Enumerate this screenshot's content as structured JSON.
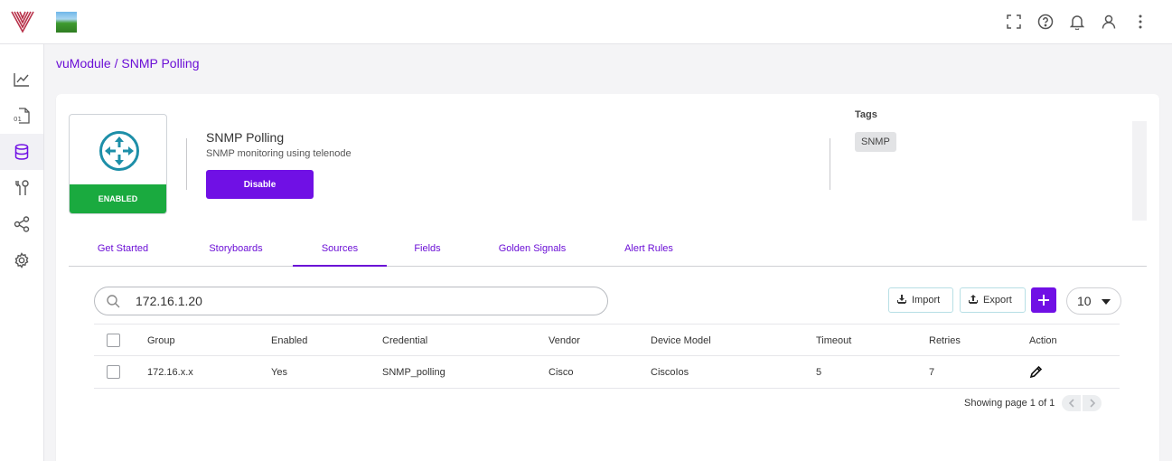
{
  "colors": {
    "brand": "#7010e5",
    "link": "#6b0fd6",
    "enabled": "#1aaa3f",
    "logo": "#b8324a"
  },
  "topbar": {
    "icons": [
      "fullscreen-icon",
      "help-icon",
      "bell-icon",
      "user-icon",
      "more-vertical-icon"
    ]
  },
  "sidebar": {
    "items": [
      "chart-icon",
      "file-binary-icon",
      "database-icon",
      "tools-icon",
      "share-icon",
      "settings-icon"
    ],
    "active_index": 2
  },
  "breadcrumb": {
    "parent": "vuModule",
    "separator": " / ",
    "current": "SNMP Polling"
  },
  "module": {
    "status": "ENABLED",
    "title": "SNMP Polling",
    "description": "SNMP monitoring using telenode",
    "action_label": "Disable",
    "tags_label": "Tags",
    "tags": [
      "SNMP"
    ]
  },
  "tabs": [
    {
      "label": "Get Started"
    },
    {
      "label": "Storyboards"
    },
    {
      "label": "Sources"
    },
    {
      "label": "Fields"
    },
    {
      "label": "Golden Signals"
    },
    {
      "label": "Alert Rules"
    }
  ],
  "active_tab": "Sources",
  "search": {
    "value": "172.16.1.20"
  },
  "toolbar": {
    "import_label": "Import",
    "export_label": "Export",
    "page_size": "10"
  },
  "table": {
    "columns": [
      "Group",
      "Enabled",
      "Credential",
      "Vendor",
      "Device Model",
      "Timeout",
      "Retries",
      "Action"
    ],
    "rows": [
      [
        "172.16.x.x",
        "Yes",
        "SNMP_polling",
        "Cisco",
        "CiscoIos",
        "5",
        "7"
      ]
    ]
  },
  "pagination": {
    "text": "Showing page 1 of 1"
  }
}
